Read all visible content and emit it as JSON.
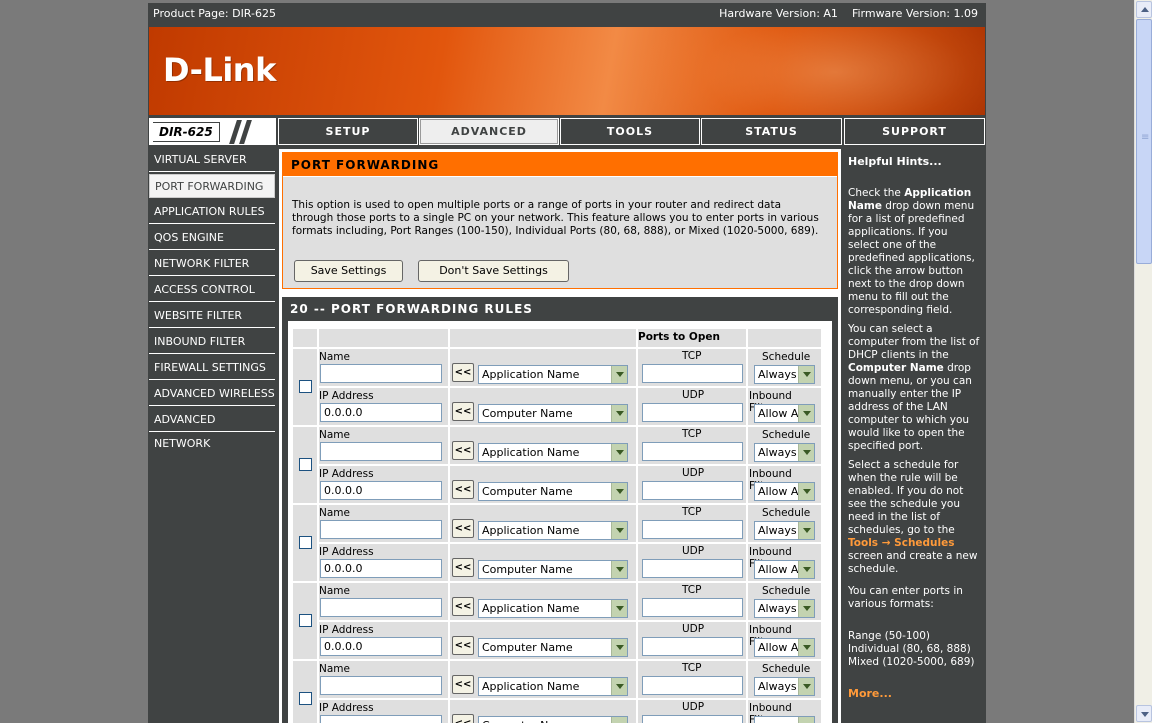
{
  "infobar": {
    "product": "Product Page: DIR-625",
    "hardware": "Hardware Version: A1",
    "firmware": "Firmware Version: 1.09"
  },
  "brand": {
    "logo": "D-Link"
  },
  "model": "DIR-625",
  "tabs": [
    {
      "label": "SETUP",
      "active": false
    },
    {
      "label": "ADVANCED",
      "active": true
    },
    {
      "label": "TOOLS",
      "active": false
    },
    {
      "label": "STATUS",
      "active": false
    },
    {
      "label": "SUPPORT",
      "active": false
    }
  ],
  "sidebar": {
    "items": [
      {
        "label": "VIRTUAL SERVER",
        "active": false
      },
      {
        "label": "PORT FORWARDING",
        "active": true
      },
      {
        "label": "APPLICATION RULES",
        "active": false
      },
      {
        "label": "QOS ENGINE",
        "active": false
      },
      {
        "label": "NETWORK FILTER",
        "active": false
      },
      {
        "label": "ACCESS CONTROL",
        "active": false
      },
      {
        "label": "WEBSITE FILTER",
        "active": false
      },
      {
        "label": "INBOUND FILTER",
        "active": false
      },
      {
        "label": "FIREWALL SETTINGS",
        "active": false
      },
      {
        "label": "ADVANCED WIRELESS",
        "active": false
      },
      {
        "label": "ADVANCED NETWORK",
        "active": false
      }
    ]
  },
  "port_forwarding": {
    "title": "PORT FORWARDING",
    "description": "This option is used to open multiple ports or a range of ports in your router and redirect data through those ports to a single PC on your network. This feature allows you to enter ports in various formats including, Port Ranges (100-150), Individual Ports (80, 68, 888), or Mixed (1020-5000, 689).",
    "save_label": "Save Settings",
    "dont_save_label": "Don't Save Settings"
  },
  "rules": {
    "title": "20 -- PORT FORWARDING RULES",
    "ports_header": "Ports to Open",
    "name_label": "Name",
    "ip_label": "IP Address",
    "tcp_label": "TCP",
    "udp_label": "UDP",
    "schedule_label": "Schedule",
    "inbound_label": "Inbound Filter",
    "transfer_label": "<<",
    "app_name_placeholder": "Application Name",
    "computer_name_placeholder": "Computer Name",
    "rows": [
      {
        "name": "",
        "ip": "0.0.0.0",
        "tcp": "",
        "udp": "",
        "schedule": "Always",
        "inbound": "Allow All",
        "enabled": false
      },
      {
        "name": "",
        "ip": "0.0.0.0",
        "tcp": "",
        "udp": "",
        "schedule": "Always",
        "inbound": "Allow All",
        "enabled": false
      },
      {
        "name": "",
        "ip": "0.0.0.0",
        "tcp": "",
        "udp": "",
        "schedule": "Always",
        "inbound": "Allow All",
        "enabled": false
      },
      {
        "name": "",
        "ip": "0.0.0.0",
        "tcp": "",
        "udp": "",
        "schedule": "Always",
        "inbound": "Allow All",
        "enabled": false
      },
      {
        "name": "",
        "ip": "",
        "tcp": "",
        "udp": "",
        "schedule": "Always",
        "inbound": "",
        "enabled": false
      }
    ]
  },
  "hints": {
    "title": "Helpful Hints...",
    "p1_a": "Check the ",
    "p1_b": "Application Name",
    "p1_c": " drop down menu for a list of predefined applications. If you select one of the predefined applications, click the arrow button next to the drop down menu to fill out the corresponding field.",
    "p2_a": "You can select a computer from the list of DHCP clients in the ",
    "p2_b": "Computer Name",
    "p2_c": " drop down menu, or you can manually enter the IP address of the LAN computer to which you would like to open the specified port.",
    "p3_a": "Select a schedule for when the rule will be enabled. If you do not see the schedule you need in the list of schedules, go to the ",
    "p3_link": "Tools → Schedules",
    "p3_c": " screen and create a new schedule.",
    "p4": "You can enter ports in various formats:",
    "p5_1": "Range (50-100)",
    "p5_2": "Individual (80, 68, 888)",
    "p5_3": "Mixed (1020-5000, 689)",
    "more": "More..."
  },
  "colors": {
    "panel_dark": "#404343",
    "accent_orange": "#ff6f00",
    "link_orange": "#ff9a3a"
  }
}
